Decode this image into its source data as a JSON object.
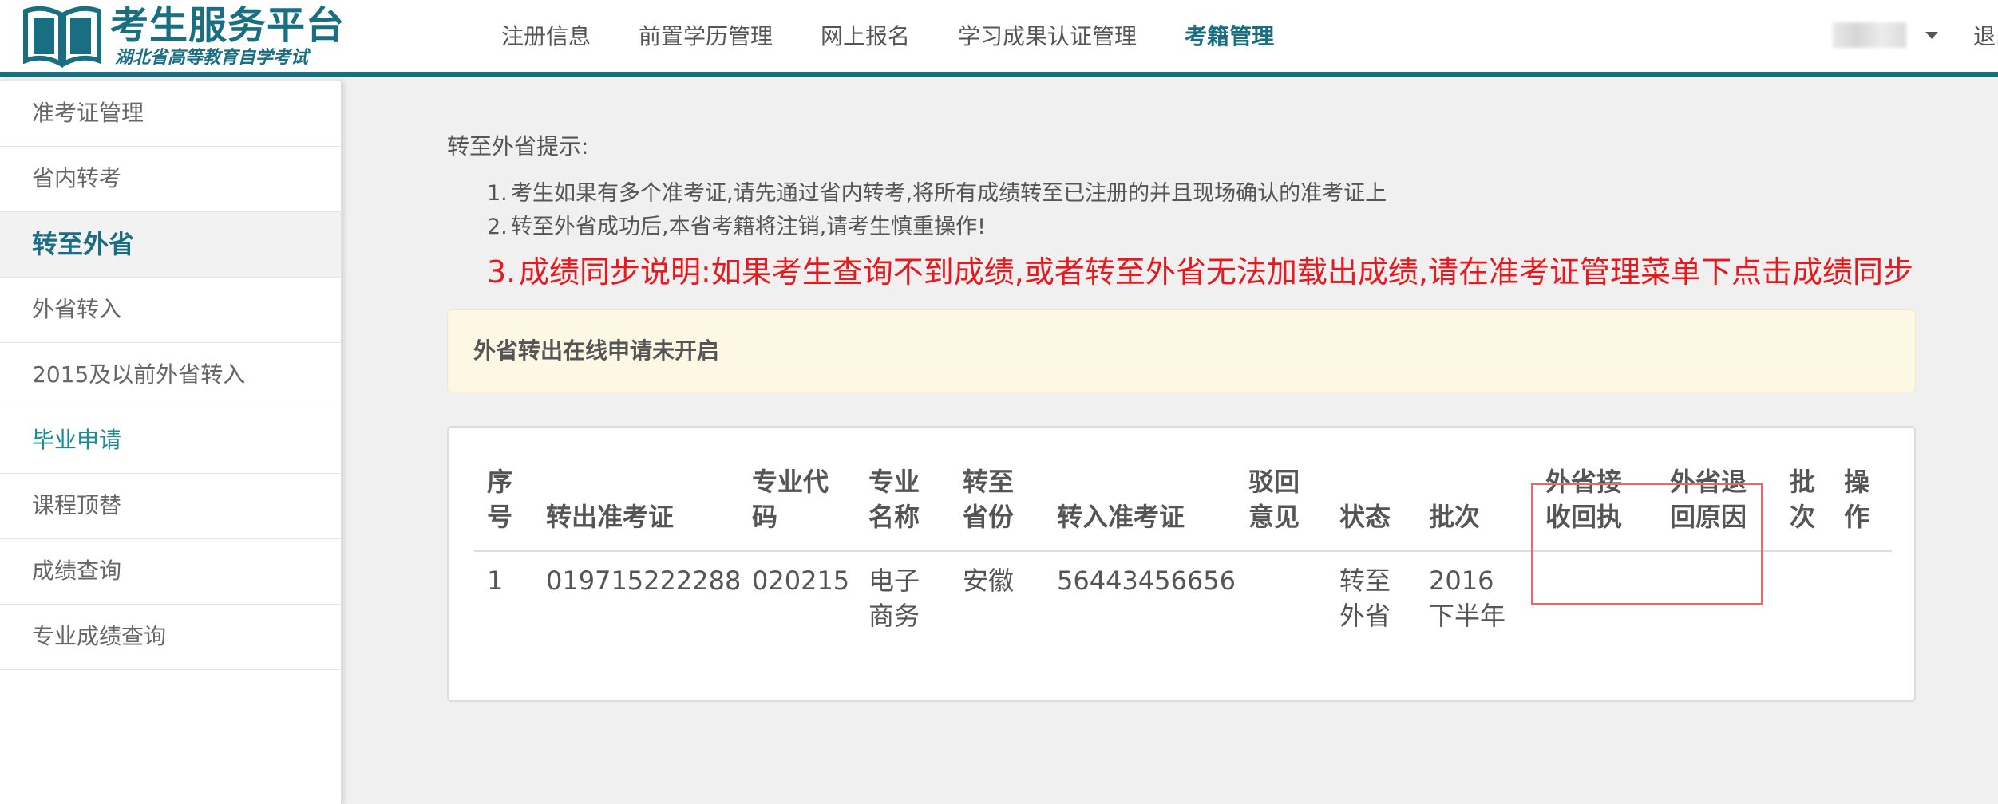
{
  "header": {
    "logo_title": "考生服务平台",
    "logo_subtitle": "湖北省高等教育自学考试",
    "nav": [
      {
        "label": "注册信息",
        "active": false
      },
      {
        "label": "前置学历管理",
        "active": false
      },
      {
        "label": "网上报名",
        "active": false
      },
      {
        "label": "学习成果认证管理",
        "active": false
      },
      {
        "label": "考籍管理",
        "active": true
      }
    ],
    "logout_label": "退出"
  },
  "sidebar": {
    "items": [
      {
        "label": "准考证管理"
      },
      {
        "label": "省内转考"
      },
      {
        "label": "转至外省"
      },
      {
        "label": "外省转入"
      },
      {
        "label": "2015及以前外省转入"
      },
      {
        "label": "毕业申请"
      },
      {
        "label": "课程顶替"
      },
      {
        "label": "成绩查询"
      },
      {
        "label": "专业成绩查询"
      }
    ]
  },
  "main": {
    "tip_title": "转至外省提示:",
    "tips": [
      {
        "num": "1.",
        "text": "考生如果有多个准考证,请先通过省内转考,将所有成绩转至已注册的并且现场确认的准考证上"
      },
      {
        "num": "2.",
        "text": "转至外省成功后,本省考籍将注销,请考生慎重操作!"
      }
    ],
    "tip_red": {
      "num": "3.",
      "text": "成绩同步说明:如果考生查询不到成绩,或者转至外省无法加载出成绩,请在准考证管理菜单下点击成绩同步"
    },
    "notice": "外省转出在线申请未开启"
  },
  "table": {
    "headers": {
      "seq": [
        "序",
        "号"
      ],
      "out_ticket": "转出准考证",
      "major_code": [
        "专业代",
        "码"
      ],
      "major_name": [
        "专业",
        "名称"
      ],
      "to_province": [
        "转至",
        "省份"
      ],
      "in_ticket": "转入准考证",
      "reject": [
        "驳回",
        "意见"
      ],
      "status": "状态",
      "batch": "批次",
      "receipt": [
        "外省接",
        "收回执"
      ],
      "return_reason": [
        "外省退",
        "回原因"
      ],
      "batch2": [
        "批",
        "次"
      ],
      "op": [
        "操",
        "作"
      ]
    },
    "rows": [
      {
        "seq": "1",
        "out_ticket": "019715222288",
        "major_code": "020215",
        "major_name": [
          "电子",
          "商务"
        ],
        "to_province": "安徽",
        "in_ticket": "56443456656",
        "status": [
          "转至",
          "外省"
        ],
        "batch": [
          "2016",
          "下半年"
        ]
      }
    ]
  }
}
